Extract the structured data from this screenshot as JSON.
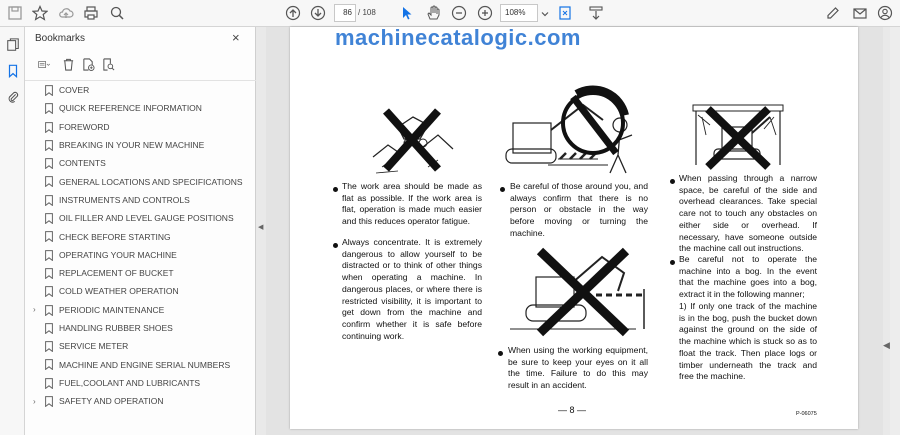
{
  "toolbar": {
    "page_current": "86",
    "page_total": "/ 108",
    "zoom": "108%"
  },
  "panel": {
    "title": "Bookmarks",
    "close_glyph": "×"
  },
  "bookmarks": [
    {
      "label": "COVER",
      "expandable": false
    },
    {
      "label": "QUICK REFERENCE INFORMATION",
      "expandable": false
    },
    {
      "label": "FOREWORD",
      "expandable": false
    },
    {
      "label": "BREAKING IN YOUR NEW MACHINE",
      "expandable": false
    },
    {
      "label": "CONTENTS",
      "expandable": false
    },
    {
      "label": "GENERAL LOCATIONS AND SPECIFICATIONS",
      "expandable": false
    },
    {
      "label": "INSTRUMENTS AND CONTROLS",
      "expandable": false
    },
    {
      "label": "OIL FILLER AND LEVEL GAUGE POSITIONS",
      "expandable": false
    },
    {
      "label": "CHECK BEFORE STARTING",
      "expandable": false
    },
    {
      "label": "OPERATING YOUR MACHINE",
      "expandable": false
    },
    {
      "label": "REPLACEMENT OF BUCKET",
      "expandable": false
    },
    {
      "label": "COLD WEATHER OPERATION",
      "expandable": false
    },
    {
      "label": "PERIODIC MAINTENANCE",
      "expandable": true
    },
    {
      "label": "HANDLING RUBBER SHOES",
      "expandable": false
    },
    {
      "label": "SERVICE METER",
      "expandable": false
    },
    {
      "label": "MACHINE AND ENGINE SERIAL NUMBERS",
      "expandable": false
    },
    {
      "label": "FUEL,COOLANT AND LUBRICANTS",
      "expandable": false
    },
    {
      "label": "SAFETY AND OPERATION",
      "expandable": true
    }
  ],
  "document": {
    "watermark": "machinecatalogic.com",
    "col1_p1": "The work area should be made as flat as possible. If the work area is flat, operation is made much easier and this reduces operator fatigue.",
    "col1_p2": "Always concentrate. It is extremely dangerous to allow yourself to be distracted or to think of other things when operating a machine. In dangerous places, or where there is restricted visibility, it is important to get down from the machine and confirm whether it is safe before continuing work.",
    "col2_p1": "Be careful of those around you, and always confirm that there is no person or obstacle in the way before moving or turning the machine.",
    "col2_p2": "When using the working equipment, be sure to keep your eyes on it all the time. Failure to do this may result in an accident.",
    "col3_p1": "When passing through a narrow space, be careful of the side and overhead clearances. Take special care not to touch any obstacles on either side or overhead. If necessary, have someone outside the machine call out instructions.",
    "col3_p2": "Be careful not to operate the machine into a bog. In the event that the machine goes into a bog, extract it in the following manner;",
    "col3_p3": "1) If only one track of the machine is in the bog, push the bucket down against the ground on the side of the machine which is stuck so as to float the track. Then place logs or timber underneath the track and free the machine.",
    "page_number": "— 8 —",
    "page_code": "P-06075"
  }
}
